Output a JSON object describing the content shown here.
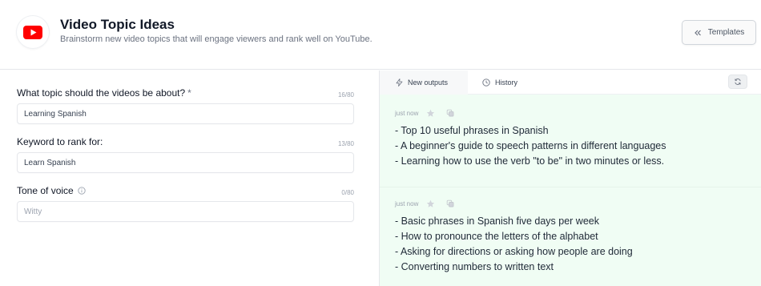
{
  "header": {
    "title": "Video Topic Ideas",
    "subtitle": "Brainstorm new video topics that will engage viewers and rank well on YouTube.",
    "templates_label": "Templates",
    "icons": {
      "logo": "youtube-logo-icon",
      "templates": "chevrons-left-icon"
    },
    "colors": {
      "youtube_red": "#ff0000"
    }
  },
  "form": {
    "topic": {
      "label": "What topic should the videos be about?",
      "required_mark": "*",
      "counter": "16/80",
      "value": "Learning Spanish"
    },
    "keyword": {
      "label": "Keyword to rank for:",
      "counter": "13/80",
      "value": "Learn Spanish"
    },
    "tone": {
      "label": "Tone of voice",
      "counter": "0/80",
      "value": "",
      "placeholder": "Witty",
      "icon": "info-icon"
    }
  },
  "output_panel": {
    "tabs": [
      {
        "label": "New outputs",
        "icon": "lightning-icon",
        "active": true
      },
      {
        "label": "History",
        "icon": "clock-icon",
        "active": false
      }
    ],
    "regenerate_icon": "refresh-icon",
    "background": "#f0fdf4",
    "outputs": [
      {
        "time": "just now",
        "lines": [
          "- Top 10 useful phrases in Spanish",
          "- A beginner's guide to speech patterns in different languages",
          "- Learning how to use the verb \"to be\" in two minutes or less."
        ]
      },
      {
        "time": "just now",
        "lines": [
          "- Basic phrases in Spanish five days per week",
          "- How to pronounce the letters of the alphabet",
          "- Asking for directions or asking how people are doing",
          "- Converting numbers to written text"
        ]
      }
    ]
  }
}
